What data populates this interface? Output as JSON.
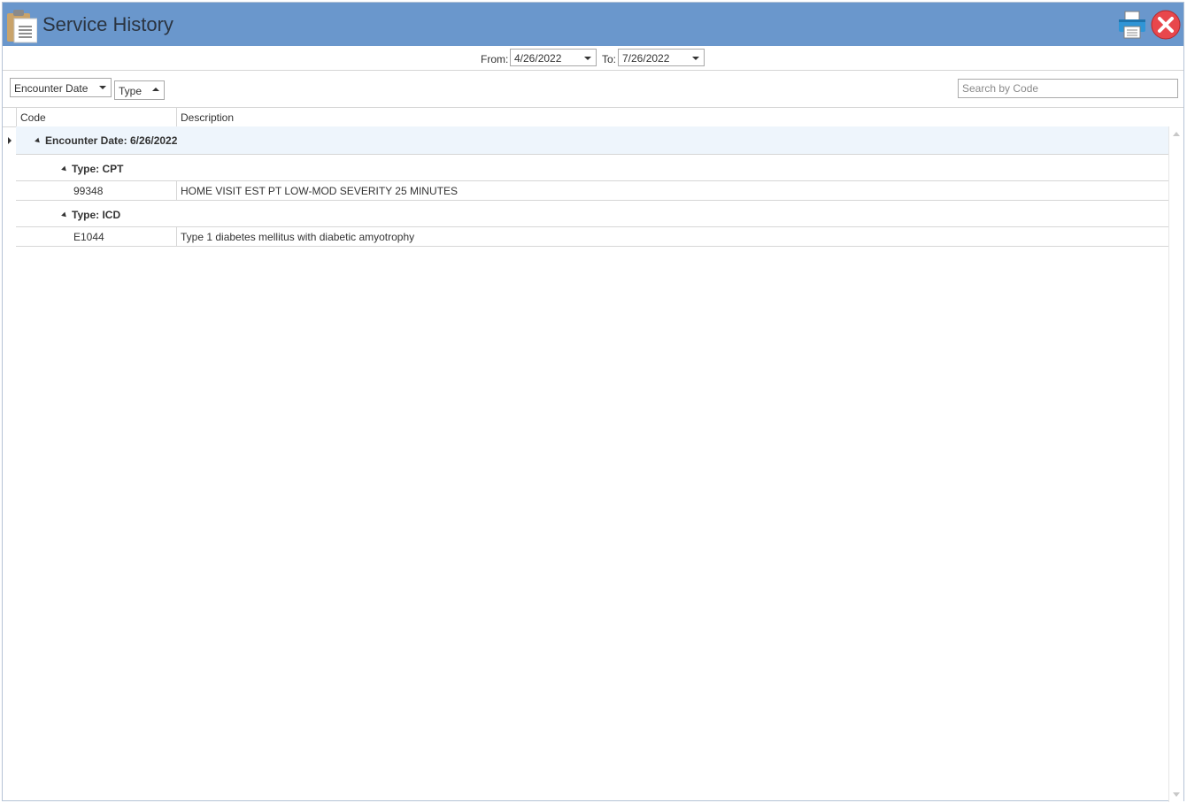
{
  "window": {
    "title": "Service History",
    "icons": {
      "app": "clipboard-list-icon",
      "print": "printer-icon",
      "close": "close-icon"
    },
    "colors": {
      "titlebar": "#6a97cc",
      "close": "#e8474c",
      "group_highlight": "#eef5fc"
    }
  },
  "date_filter": {
    "from_label": "From:",
    "from_value": "4/26/2022",
    "to_label": "To:",
    "to_value": "7/26/2022"
  },
  "grouping": {
    "group1_label": "Encounter Date",
    "group2_label": "Type"
  },
  "search": {
    "placeholder": "Search by Code",
    "value": ""
  },
  "grid": {
    "columns": {
      "code": "Code",
      "description": "Description"
    },
    "groups": [
      {
        "label": "Encounter Date: 6/26/2022",
        "subgroups": [
          {
            "label": "Type: CPT",
            "rows": [
              {
                "code": "99348",
                "description": "HOME VISIT EST PT LOW-MOD SEVERITY 25 MINUTES"
              }
            ]
          },
          {
            "label": "Type: ICD",
            "rows": [
              {
                "code": "E1044",
                "description": "Type 1 diabetes mellitus with diabetic amyotrophy"
              }
            ]
          }
        ]
      }
    ]
  }
}
